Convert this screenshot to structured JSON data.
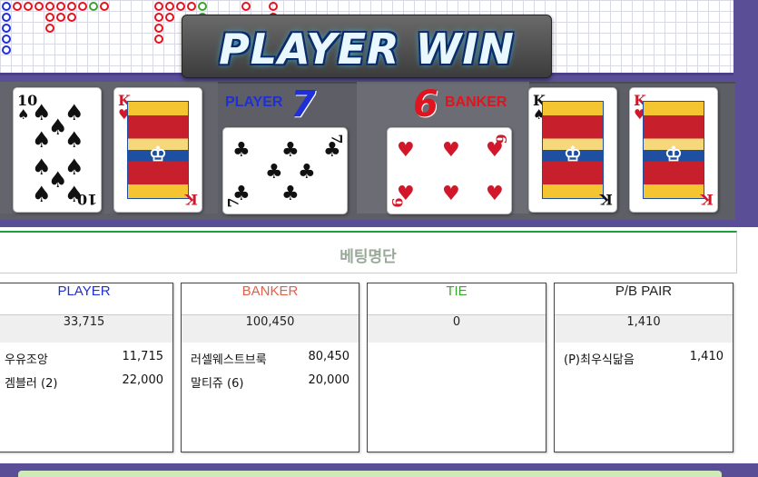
{
  "result": {
    "banner_text": "PLAYER WIN",
    "player_label": "PLAYER",
    "player_score": "7",
    "banker_label": "BANKER",
    "banker_score": "6"
  },
  "cards": {
    "player": [
      {
        "rank": "10",
        "suit": "spades",
        "symbol": "♠",
        "color": "#111111"
      },
      {
        "rank": "K",
        "suit": "hearts",
        "symbol": "♥",
        "color": "#d1182a"
      },
      {
        "rank": "7",
        "suit": "clubs",
        "symbol": "♣",
        "color": "#111111"
      }
    ],
    "banker": [
      {
        "rank": "6",
        "suit": "hearts",
        "symbol": "♥",
        "color": "#d1182a"
      },
      {
        "rank": "K",
        "suit": "spades",
        "symbol": "♠",
        "color": "#111111"
      },
      {
        "rank": "K",
        "suit": "hearts",
        "symbol": "♥",
        "color": "#d1182a"
      }
    ]
  },
  "betting_list": {
    "title": "베팅명단",
    "columns": [
      {
        "title": "PLAYER",
        "color": "#1e2fd6",
        "total": "33,715",
        "rows": [
          {
            "name": "우유조앙",
            "amount": "11,715"
          },
          {
            "name": "겜블러 (2)",
            "amount": "22,000"
          }
        ]
      },
      {
        "title": "BANKER",
        "color": "#e2604a",
        "total": "100,450",
        "rows": [
          {
            "name": "러셀웨스트브룩",
            "amount": "80,450"
          },
          {
            "name": "말티쥬 (6)",
            "amount": "20,000"
          }
        ]
      },
      {
        "title": "TIE",
        "color": "#3aa52e",
        "total": "0",
        "rows": []
      },
      {
        "title": "P/B PAIR",
        "color": "#222222",
        "total": "1,410",
        "rows": [
          {
            "name": "(P)최우식닮음",
            "amount": "1,410"
          }
        ]
      }
    ]
  },
  "colors": {
    "player": "#1e2fd6",
    "banker": "#e0141f",
    "tie": "#3aa52e",
    "frame": "#5a4f96",
    "accent_line": "#1e9e3e"
  }
}
